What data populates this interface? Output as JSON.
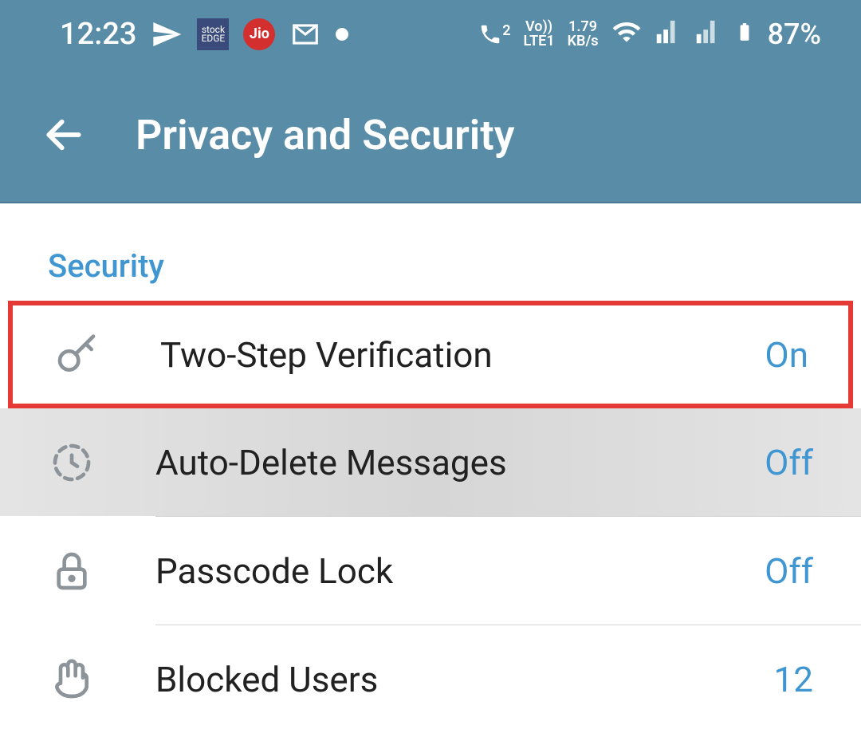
{
  "statusBar": {
    "time": "12:23",
    "networkSpeed": "1.79",
    "networkSpeedUnit": "KB/s",
    "volte": "Vo))",
    "lte": "LTE1",
    "callBadge": "2",
    "battery": "87%",
    "jioLabel": "Jio",
    "stockLabel": "stock\nEDGE"
  },
  "appBar": {
    "title": "Privacy and Security"
  },
  "section": {
    "title": "Security",
    "items": [
      {
        "label": "Two-Step Verification",
        "value": "On"
      },
      {
        "label": "Auto-Delete Messages",
        "value": "Off"
      },
      {
        "label": "Passcode Lock",
        "value": "Off"
      },
      {
        "label": "Blocked Users",
        "value": "12"
      }
    ]
  }
}
